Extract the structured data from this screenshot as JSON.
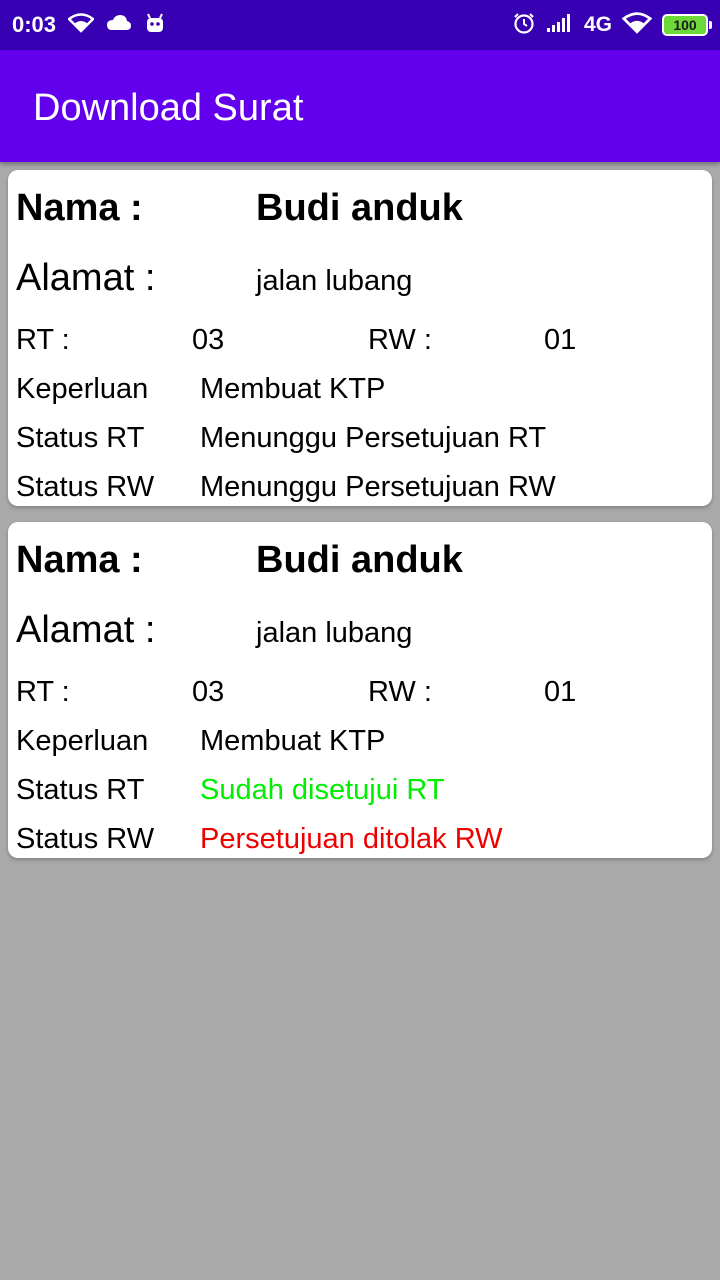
{
  "status_bar": {
    "time": "0:03",
    "network": "4G",
    "battery": "100"
  },
  "app_bar": {
    "title": "Download Surat"
  },
  "labels": {
    "nama": "Nama :",
    "alamat": "Alamat :",
    "rt": "RT :",
    "rw": "RW :",
    "keperluan": "Keperluan",
    "status_rt": "Status RT",
    "status_rw": "Status RW"
  },
  "cards": [
    {
      "nama": "Budi anduk",
      "alamat": "jalan lubang",
      "rt": "03",
      "rw": "01",
      "keperluan": "Membuat KTP",
      "status_rt": "Menunggu Persetujuan RT",
      "status_rt_color": "#000000",
      "status_rw": "Menunggu Persetujuan RW",
      "status_rw_color": "#000000"
    },
    {
      "nama": "Budi anduk",
      "alamat": "jalan lubang",
      "rt": "03",
      "rw": "01",
      "keperluan": "Membuat KTP",
      "status_rt": "Sudah disetujui RT",
      "status_rt_color": "#00ee00",
      "status_rw": "Persetujuan ditolak RW",
      "status_rw_color": "#ee0000"
    }
  ],
  "colors": {
    "status_bar": "#3700b3",
    "app_bar": "#6200ee",
    "background": "#aaaaaa"
  }
}
